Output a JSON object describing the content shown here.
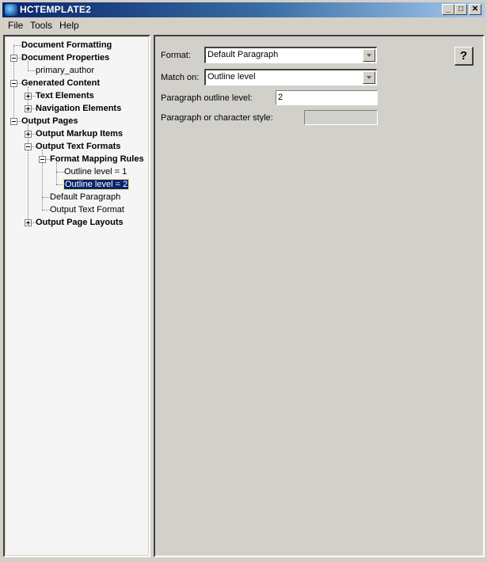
{
  "window": {
    "title": "HCTEMPLATE2",
    "icon": "app-globe-icon",
    "controls": {
      "minimize": "_",
      "maximize": "□",
      "close": "✕"
    }
  },
  "menubar": {
    "items": [
      "File",
      "Tools",
      "Help"
    ]
  },
  "tree": {
    "nodes": [
      {
        "label": "Document Formatting",
        "level": 0,
        "bold": true,
        "expander": "none"
      },
      {
        "label": "Document Properties",
        "level": 0,
        "bold": true,
        "expander": "minus"
      },
      {
        "label": "primary_author",
        "level": 1,
        "bold": false,
        "expander": "none"
      },
      {
        "label": "Generated Content",
        "level": 0,
        "bold": true,
        "expander": "minus"
      },
      {
        "label": "Text Elements",
        "level": 1,
        "bold": true,
        "expander": "plus"
      },
      {
        "label": "Navigation Elements",
        "level": 1,
        "bold": true,
        "expander": "plus"
      },
      {
        "label": "Output Pages",
        "level": 0,
        "bold": true,
        "expander": "minus"
      },
      {
        "label": "Output Markup Items",
        "level": 1,
        "bold": true,
        "expander": "plus"
      },
      {
        "label": "Output Text Formats",
        "level": 1,
        "bold": true,
        "expander": "minus"
      },
      {
        "label": "Format Mapping Rules",
        "level": 2,
        "bold": true,
        "expander": "minus"
      },
      {
        "label": "Outline level = 1",
        "level": 3,
        "bold": false,
        "expander": "none"
      },
      {
        "label": "Outline level = 2",
        "level": 3,
        "bold": false,
        "expander": "none",
        "selected": true
      },
      {
        "label": "Default Paragraph",
        "level": 2,
        "bold": false,
        "expander": "none"
      },
      {
        "label": "Output Text Format",
        "level": 2,
        "bold": false,
        "expander": "none"
      },
      {
        "label": "Output Page Layouts",
        "level": 1,
        "bold": true,
        "expander": "plus"
      }
    ]
  },
  "form": {
    "format_label": "Format:",
    "format_value": "Default Paragraph",
    "match_label": "Match on:",
    "match_value": "Outline level",
    "outline_label": "Paragraph outline level:",
    "outline_value": "2",
    "style_label": "Paragraph or character style:",
    "style_value": "",
    "help_label": "?"
  }
}
